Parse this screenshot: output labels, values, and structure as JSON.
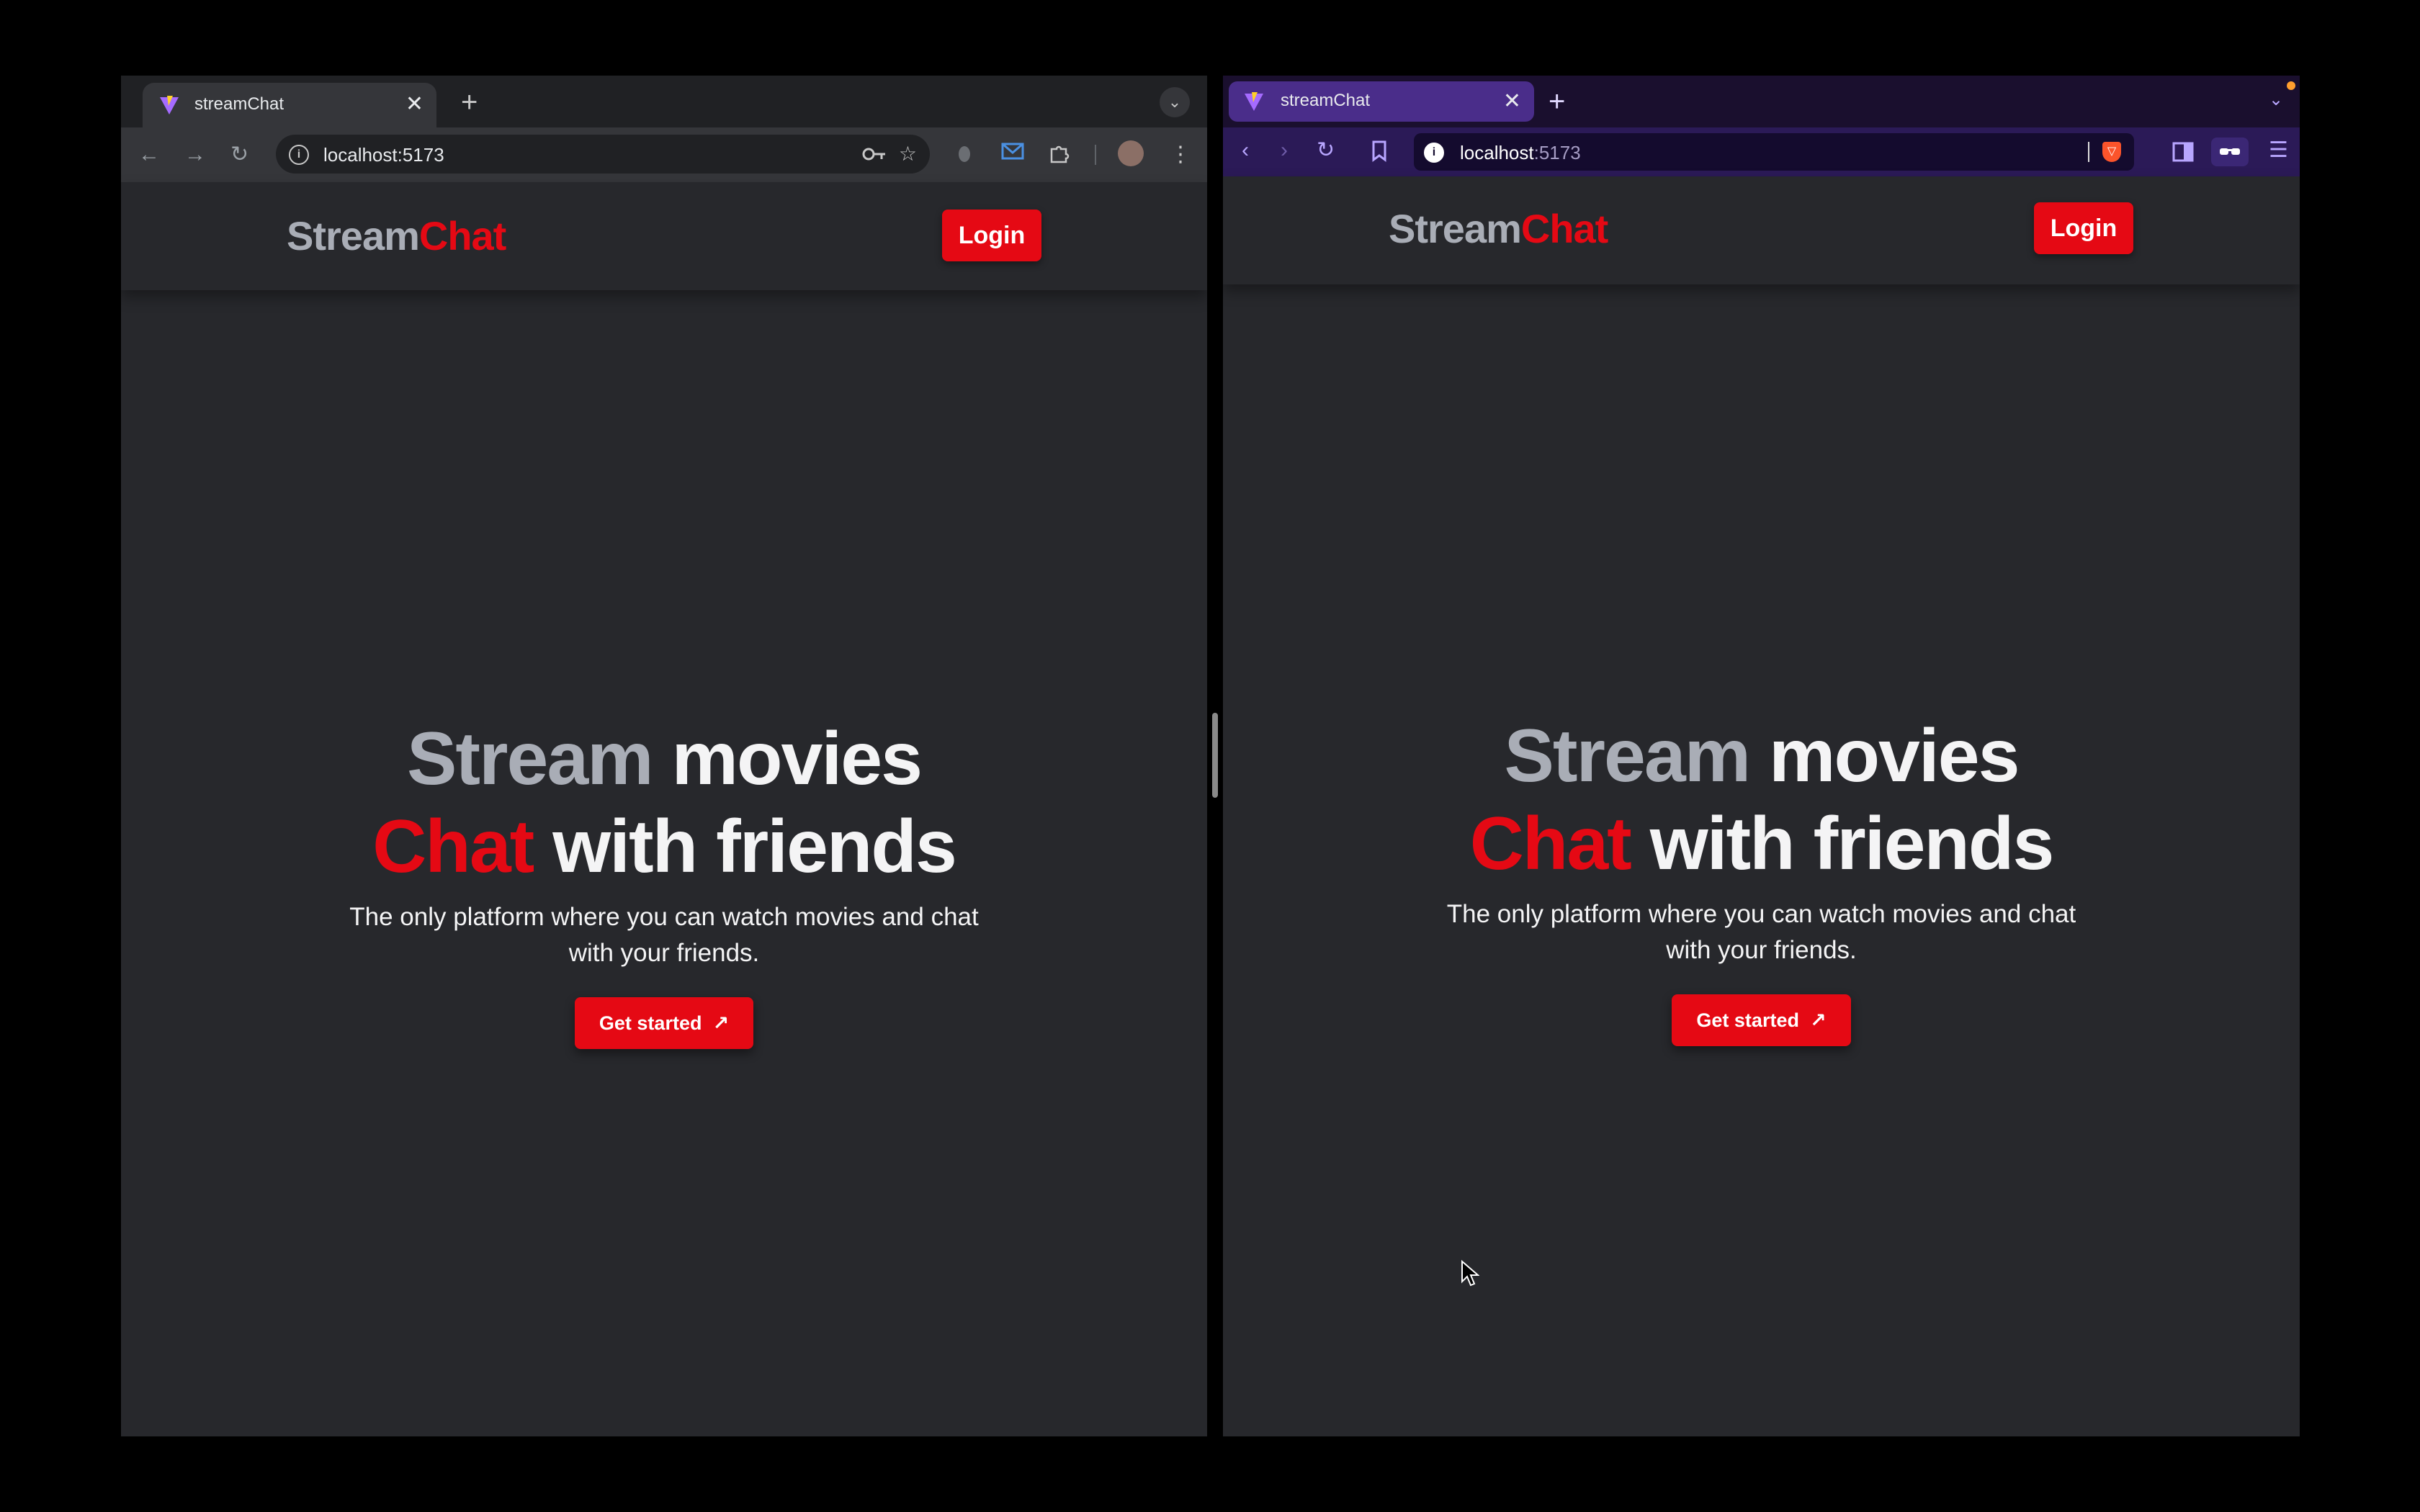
{
  "left_browser": {
    "tab_title": "streamChat",
    "url": "localhost:5173"
  },
  "right_browser": {
    "tab_title": "streamChat",
    "url_host": "localhost",
    "url_port": ":5173"
  },
  "site": {
    "logo_part1": "Stream",
    "logo_part2": "Chat",
    "login_label": "Login",
    "hero_word1": "Stream",
    "hero_word2": "movies",
    "hero_word3": "Chat",
    "hero_word4": "with friends",
    "subtitle": "The only platform where you can watch movies and chat with your friends.",
    "cta_label": "Get started",
    "cta_arrow": "↗"
  },
  "icons": {
    "close": "✕",
    "new_tab": "+",
    "back": "←",
    "forward": "→",
    "reload": "↻",
    "star": "☆",
    "menu_dots": "⋮",
    "hamburger": "☰"
  },
  "colors": {
    "accent_red": "#e50914",
    "page_bg": "#27282c",
    "brave_purple": "#4a2d8a"
  }
}
